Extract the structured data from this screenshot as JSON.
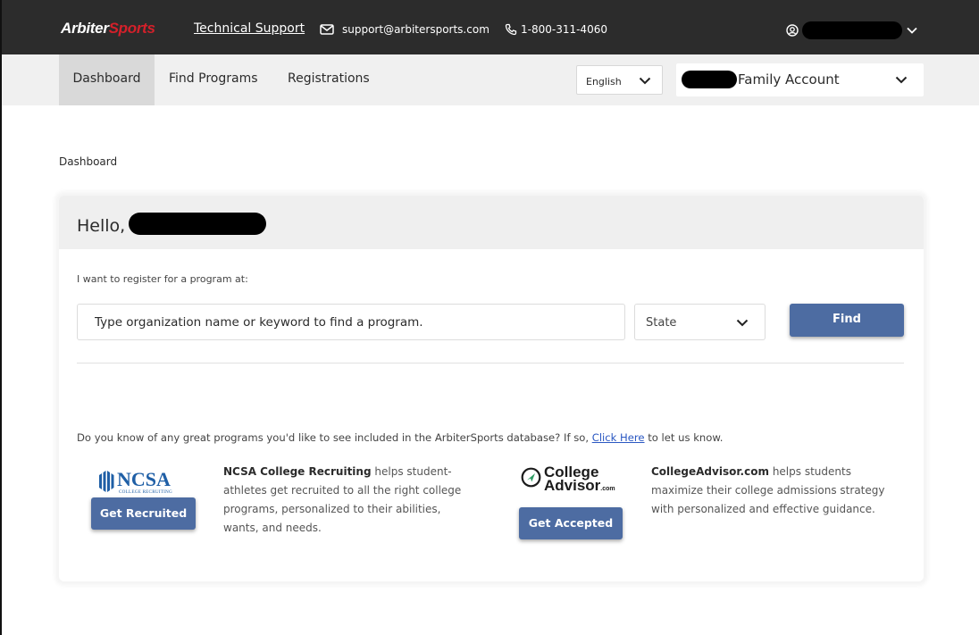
{
  "header": {
    "logo_part1": "Arbiter",
    "logo_part2": "Sports",
    "tech_support": "Technical Support",
    "email": "support@arbitersports.com",
    "phone": "1-800-311-4060"
  },
  "nav": {
    "tabs": [
      {
        "label": "Dashboard",
        "active": true
      },
      {
        "label": "Find Programs",
        "active": false
      },
      {
        "label": "Registrations",
        "active": false
      }
    ],
    "language": "English",
    "account_label": "Family Account"
  },
  "breadcrumb": "Dashboard",
  "card": {
    "greeting": "Hello,",
    "register_label": "I want to register for a program at:",
    "search_placeholder": "Type organization name or keyword to find a program.",
    "state_select": "State",
    "find_button": "Find",
    "suggest_text": "Do you know of any great programs you'd like to see included in the ArbiterSports database? If so,",
    "suggest_link": "Click Here",
    "suggest_tail": "to let us know."
  },
  "promos": {
    "ncsa": {
      "logo_text": "NCSA",
      "logo_sub": "COLLEGE RECRUITING",
      "button": "Get Recruited",
      "title": "NCSA College Recruiting",
      "desc": "helps student-athletes get recruited to all the right college programs, personalized to their abilities, wants, and needs."
    },
    "college_advisor": {
      "logo_line1": "College",
      "logo_line2": "Advisor",
      "logo_suffix": ".com",
      "button": "Get Accepted",
      "title": "CollegeAdvisor.com",
      "desc": "helps students maximize their college admissions strategy with personalized and effective guidance."
    }
  },
  "colors": {
    "topbar": "#2c2c2c",
    "brand_red": "#d4202a",
    "button_blue": "#4d6ca2",
    "link_blue": "#2a57c2",
    "ncsa_blue": "#1f5fa6"
  },
  "icons": [
    "envelope-icon",
    "phone-icon",
    "user-circle-icon",
    "chevron-down-icon",
    "ncsa-shield-icon",
    "compass-arrow-icon"
  ]
}
